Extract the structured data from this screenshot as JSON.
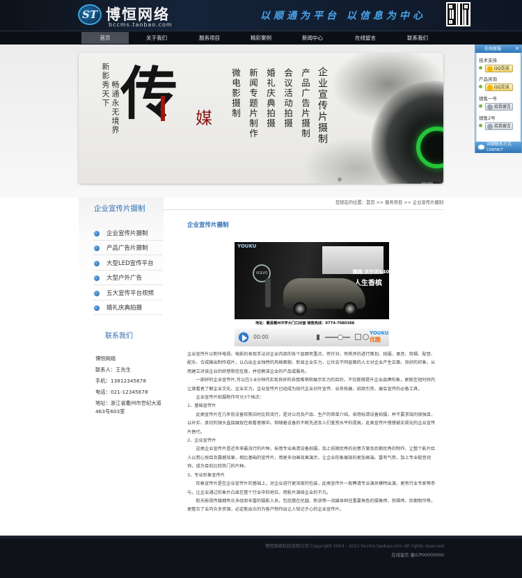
{
  "header": {
    "logo_badge": "ST",
    "logo_name": "博恒网络",
    "logo_url": "bccms.taobao.com",
    "slogan": "以顺通为平台  以信息为中心",
    "qr_icon": "qr-code-icon"
  },
  "nav": {
    "items": [
      {
        "label": "首页",
        "active": true
      },
      {
        "label": "关于我们"
      },
      {
        "label": "服务项目"
      },
      {
        "label": "精彩案例"
      },
      {
        "label": "新闻中心"
      },
      {
        "label": "在线留言"
      },
      {
        "label": "联系我们"
      }
    ]
  },
  "banner": {
    "vertical_small_1": "新影秀天下",
    "vertical_small_2": "畅通永无境界",
    "big_char": "传",
    "red_char": "媒",
    "columns": [
      "微电影摄制",
      "新闻专题片制作",
      "婚礼庆典拍摄",
      "会议活动拍摄",
      "产品广告片摄制",
      "企业宣传片摄制"
    ],
    "slide_count": 3,
    "current_slide": 3
  },
  "qq_panel": {
    "title": "在线客服",
    "close": "✕",
    "groups": [
      {
        "label": "技术支持",
        "btn": "QQ交谈",
        "online": true
      },
      {
        "label": "产品咨询",
        "btn": "QQ交谈",
        "online": true
      },
      {
        "label": "销售一号",
        "btn": "给我留言",
        "online": false
      },
      {
        "label": "销售2号",
        "btn": "给我留言",
        "online": false
      }
    ],
    "footer_line1": "详细联系方式",
    "footer_line2": "CONTACT"
  },
  "sidebar": {
    "title": "企业宣传片摄制",
    "items": [
      "企业宣传片摄制",
      "产品广告片摄制",
      "大型LED宣传平台",
      "大型户外广告",
      "五大宣传平台视频",
      "婚礼庆典拍摄"
    ],
    "contact_title": "联系我们",
    "contact_lines": [
      "博恒网络",
      "联系人：王先生",
      "手机：13812345678",
      "电话：021-12345678",
      "地址：浙江省衢州市世纪大道463号603室"
    ]
  },
  "content": {
    "breadcrumb": "您现在的位置：首页 >> 服务项目 >> 企业宣传片摄制",
    "title": "企业宣传片摄制",
    "video": {
      "youku_top": "YOUKU",
      "brand": "VOLVO",
      "headline": "酷跑 沃尔沃S40",
      "headline2": "人生香槟",
      "address": "地址：衢县衢州中学大门口对面  销售热线：0774-7080388",
      "time": "00:00",
      "player_logo_1": "YOUKU",
      "player_logo_2": "优酷"
    },
    "paragraphs": [
      {
        "indent": false,
        "text": "企业宣传片以制作电视、电影的表现手法对企业内部的各个层面有重点、有针对、有秩序的进行策划、拍摄、录音、剪辑、配音、配乐、合成输出制作成片，以凸出企业独特的风格面貌、彰显企业实力，让社会不同层面的人士对企业产生正面、良好的印象，从而建立对该企业的好感和信任度，并信赖该企业的产品或服务。"
      },
      {
        "indent": true,
        "text": "一部好的企业宣传片,可以在3-8分钟内实现良好的自我推销和展示实力的目的，不仅能够提升企业品牌形象，更能在短时间内让观看者了解企业文化、企业实力。企业宣传片已经成为现代企业对外宣传、业务拓展、招商引资、展会宣传的必备工具。"
      },
      {
        "indent": true,
        "text": "企业宣传片拍摄制作可分3个档次："
      },
      {
        "indent": false,
        "text": "1、基础宣传片"
      },
      {
        "indent": true,
        "text": "此类宣传片在几年前设备较陈旧时比较流行，是对公司及产品、生产的简单介绍，采用标清设备拍摄，并不要求效的很独目，以补实、真切的镜头直接展现在观看者眼中。但随着设备的不断先进及人们鉴赏水平的提高，此类宣传片慢慢被正规化的企业宣传片替代。"
      },
      {
        "indent": false,
        "text": "2、企业宣传片"
      },
      {
        "indent": true,
        "text": "这类企业宣传片是近年来最流行的片种，采用专业高清设备拍摄，加上前期优秀的创意方案及后期优秀的制作，让整个影片给人以赏心悦目及震撼效果，相比基础的宣传片，用更多动画效果演示，让企业形象展现的更加高端、富有气势，加上专业配音润饰，成为目前比较热门的片种。"
      },
      {
        "indent": false,
        "text": "3、专业形象宣传片"
      },
      {
        "indent": true,
        "text": "形象宣传片是在企业宣传片的基础上，对企业进行更深度的包装，此类宣传片一般聘请专业演员模特出演，更有行业专家等参与，让企业通过形象片凸显在整个行业中的地位，用影片演绎企业的不凡。"
      },
      {
        "indent": true,
        "text": "航天影视传媒拥有众多经验丰富的摄影人员，包括擅在优越、新浪等一流媒体担任重要角色的摄像师、剪辑师、后期制作等，更整合了业内众多资源，必定能出众的为客户制作出让人铭记于心的企业宣传片。"
      }
    ]
  },
  "footer": {
    "copyright": "博恒网络科技有限公司 Copyright 2004 - 2021 bccms.taobao.com All rights reserved",
    "beian": "在线留言  备ICP00000000"
  },
  "colors": {
    "accent": "#2f6eb4",
    "header_bg": "#0e1118",
    "jade": "#25c43a",
    "banner_red": "#8a1412"
  }
}
